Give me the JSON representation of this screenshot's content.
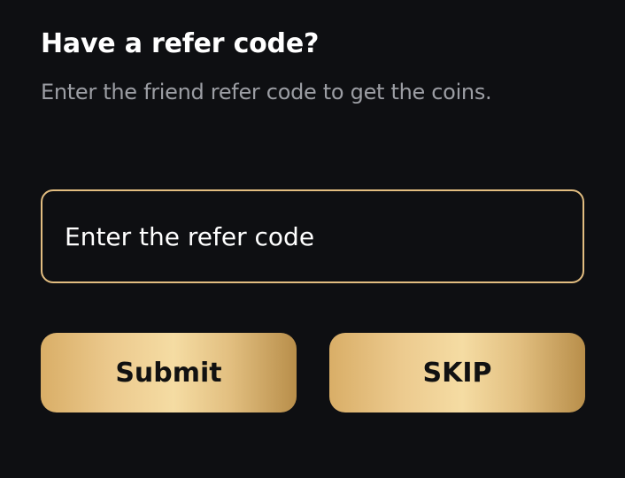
{
  "dialog": {
    "title": "Have a refer code?",
    "subtitle": "Enter the friend refer code to get the coins."
  },
  "refer_input": {
    "value": "",
    "placeholder": "Enter the refer code"
  },
  "actions": {
    "submit_label": "Submit",
    "skip_label": "SKIP"
  },
  "colors": {
    "background": "#0e0f12",
    "accent_gold": "#e2bd80",
    "title_text": "#ffffff",
    "subtitle_text": "#9c9ea4"
  }
}
